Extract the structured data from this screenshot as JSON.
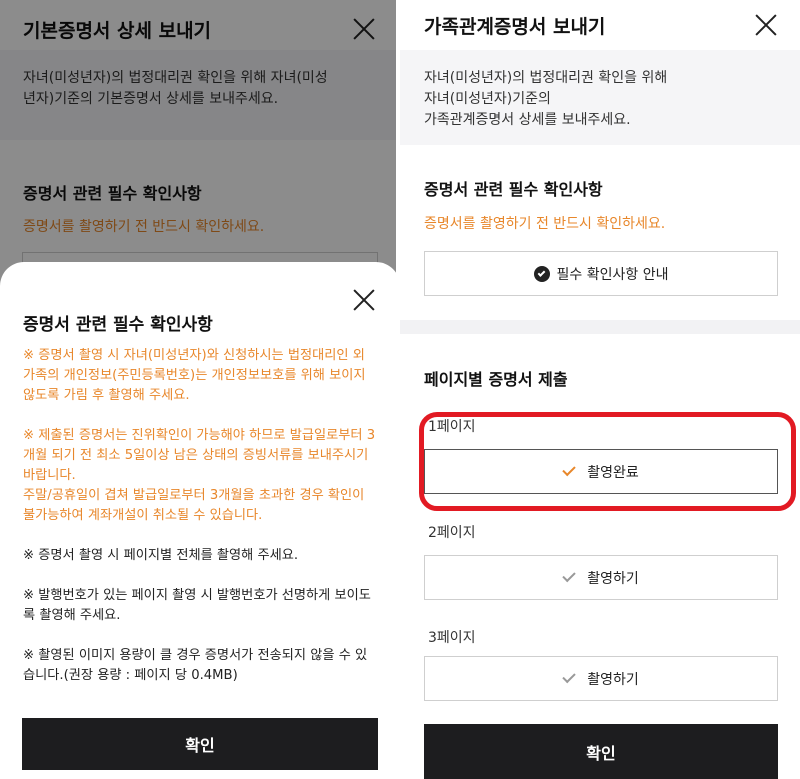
{
  "left": {
    "header_title": "기본증명서 상세 보내기",
    "intro_lines": [
      "자녀(미성년자)의 법정대리권 확인을 위해 자녀(미성",
      "년자)기준의 기본증명서 상세를 보내주세요."
    ],
    "section_title": "증명서 관련 필수 확인사항",
    "section_warning": "증명서를 촬영하기 전 반드시 확인하세요.",
    "sheet": {
      "title": "증명서 관련 필수 확인사항",
      "notice1": "※ 증명서 촬영 시 자녀(미성년자)와 신청하시는 법정대리인 외 가족의 개인정보(주민등록번호)는 개인정보보호를 위해 보이지 않도록 가림 후 촬영해 주세요.",
      "notice2": "※ 제출된 증명서는 진위확인이 가능해야 하므로 발급일로부터 3개월 되기 전 최소 5일이상 남은 상태의 증빙서류를 보내주시기 바랍니다.",
      "notice2b": "주말/공휴일이 겹쳐 발급일로부터 3개월을 초과한 경우 확인이 불가능하여 계좌개설이 취소될 수 있습니다.",
      "notice3": "※ 증명서 촬영 시 페이지별 전체를 촬영해 주세요.",
      "notice4": "※ 발행번호가 있는 페이지 촬영 시 발행번호가 선명하게 보이도록 촬영해 주세요.",
      "notice5": "※ 촬영된 이미지 용량이 클 경우 증명서가 전송되지 않을 수 있습니다.(권장 용량 : 페이지 당 0.4MB)",
      "confirm_label": "확인"
    }
  },
  "right": {
    "header_title": "가족관계증명서 보내기",
    "intro_lines": [
      "자녀(미성년자)의 법정대리권 확인을 위해",
      "자녀(미성년자)기준의",
      "가족관계증명서 상세를 보내주세요."
    ],
    "section_title": "증명서 관련 필수 확인사항",
    "section_warning": "증명서를 촬영하기 전 반드시 확인하세요.",
    "guide_button": "필수 확인사항 안내",
    "pages_title": "페이지별 증명서 제출",
    "pages": [
      {
        "label": "1페이지",
        "button": "촬영완료"
      },
      {
        "label": "2페이지",
        "button": "촬영하기"
      },
      {
        "label": "3페이지",
        "button": "촬영하기"
      }
    ],
    "confirm_label": "확인"
  },
  "colors": {
    "accent_orange": "#e8872b",
    "highlight_red": "#e21a23",
    "button_dark": "#1d1d1f"
  }
}
